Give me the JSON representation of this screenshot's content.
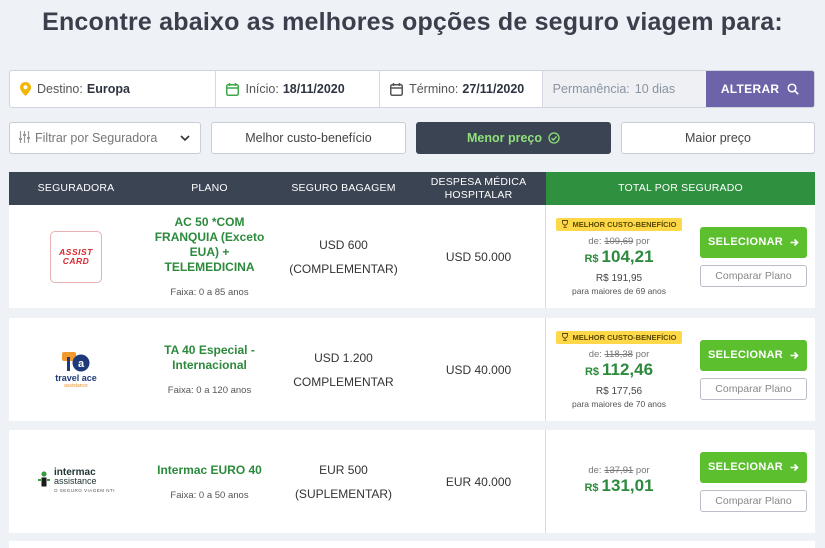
{
  "page": {
    "title": "Encontre abaixo as melhores opções de seguro viagem para:"
  },
  "search": {
    "destino_label": "Destino:",
    "destino_value": "Europa",
    "inicio_label": "Início:",
    "inicio_value": "18/11/2020",
    "termino_label": "Término:",
    "termino_value": "27/11/2020",
    "permanencia_label": "Permanência:",
    "permanencia_value": "10 dias",
    "alterar_label": "ALTERAR"
  },
  "filters": {
    "seguradora_placeholder": "Filtrar por Seguradora",
    "melhor_custo": "Melhor custo-benefício",
    "menor_preco": "Menor preço",
    "maior_preco": "Maior preço",
    "active": "menor_preco",
    "active_color": "#8fe07a"
  },
  "table": {
    "headers": {
      "seguradora": "SEGURADORA",
      "plano": "PLANO",
      "bagagem": "SEGURO BAGAGEM",
      "despesa_1": "DESPESA MÉDICA",
      "despesa_2": "HOSPITALAR",
      "total": "TOTAL POR SEGURADO"
    },
    "rows": [
      {
        "logo_icon": "assist-card-logo",
        "logo_text_1": "ASSIST",
        "logo_text_2": "CARD",
        "plan_name": "AC 50 *COM FRANQUIA (Exceto EUA) + TELEMEDICINA",
        "faixa": "Faixa: 0 a 85 anos",
        "bagagem_1": "USD 600",
        "bagagem_2": "(COMPLEMENTAR)",
        "despesa": "USD 50.000",
        "badge": "MELHOR CUSTO-BENEFÍCIO",
        "de_label": "de:",
        "de_value": "109,69",
        "por_label": "por",
        "currency": "R$",
        "price": "104,21",
        "alt_price": "R$ 191,95",
        "alt_note": "para maiores de 69 anos",
        "select_label": "SELECIONAR",
        "compare_label": "Comparar Plano"
      },
      {
        "logo_icon": "travel-ace-logo",
        "logo_text_1": "travel ace",
        "logo_text_2": "assistance",
        "plan_name": "TA 40 Especial - Internacional",
        "faixa": "Faixa: 0 a 120 anos",
        "bagagem_1": "USD 1.200",
        "bagagem_2": "COMPLEMENTAR",
        "despesa": "USD 40.000",
        "badge": "MELHOR CUSTO-BENEFÍCIO",
        "de_label": "de:",
        "de_value": "118,38",
        "por_label": "por",
        "currency": "R$",
        "price": "112,46",
        "alt_price": "R$ 177,56",
        "alt_note": "para maiores de 70 anos",
        "select_label": "SELECIONAR",
        "compare_label": "Comparar Plano"
      },
      {
        "logo_icon": "intermac-logo",
        "logo_text_1": "intermac",
        "logo_text_2": "assistance",
        "logo_text_3": "O SEGURO VIAGEM NTI",
        "plan_name": "Intermac EURO 40",
        "faixa": "Faixa: 0 a 50 anos",
        "bagagem_1": "EUR 500",
        "bagagem_2": "(SUPLEMENTAR)",
        "despesa": "EUR 40.000",
        "de_label": "de:",
        "de_value": "137,91",
        "por_label": "por",
        "currency": "R$",
        "price": "131,01",
        "select_label": "SELECIONAR",
        "compare_label": "Comparar Plano"
      }
    ]
  },
  "colors": {
    "header_dark": "#3b4453",
    "header_green": "#2f9140",
    "accent_purple": "#6d63a8",
    "price_green": "#2c8a3c",
    "button_green": "#5bbf2e",
    "badge_yellow": "#ffd84a"
  }
}
